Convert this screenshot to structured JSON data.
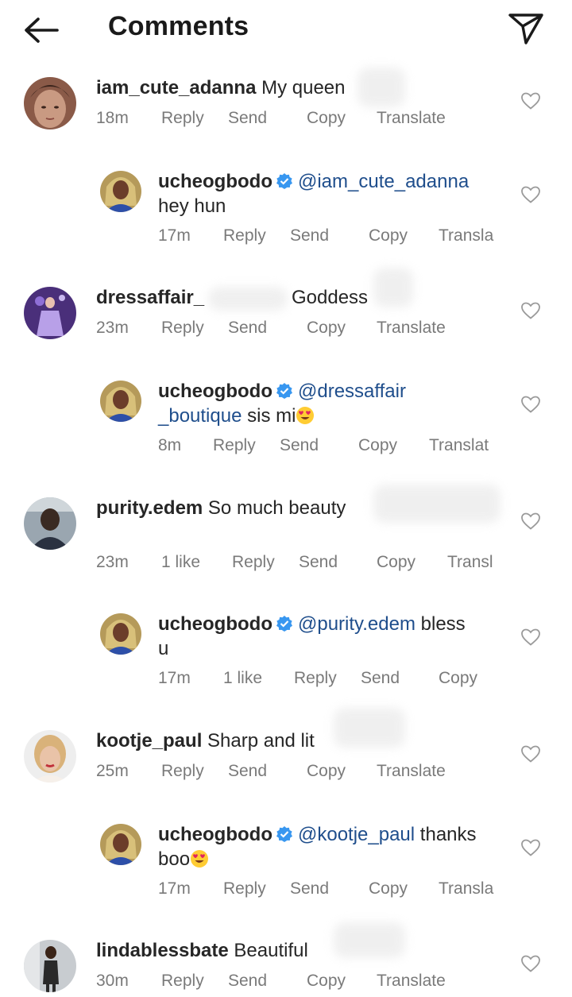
{
  "header": {
    "title": "Comments",
    "back_icon": "arrow-left-icon",
    "send_icon": "paper-plane-icon"
  },
  "comments": [
    {
      "user": "iam_cute_adanna",
      "text": "My queen",
      "time": "18m",
      "actions": [
        "Reply",
        "Send",
        "Copy",
        "Translate"
      ],
      "reply": {
        "user": "ucheogbodo",
        "verified": true,
        "mention": "@iam_cute_adanna",
        "text": "hey hun",
        "time": "17m",
        "actions": [
          "Reply",
          "Send",
          "Copy",
          "Transla"
        ]
      }
    },
    {
      "user": "dressaffair_",
      "text": "Goddess",
      "time": "23m",
      "actions": [
        "Reply",
        "Send",
        "Copy",
        "Translate"
      ],
      "reply": {
        "user": "ucheogbodo",
        "verified": true,
        "mention_line1": "@dressaffair",
        "mention_line2": "_boutique",
        "text": "sis mi",
        "time": "8m",
        "actions": [
          "Reply",
          "Send",
          "Copy",
          "Translat"
        ]
      }
    },
    {
      "user": "purity.edem",
      "text": "So much beauty",
      "time": "23m",
      "likes": "1 like",
      "actions": [
        "Reply",
        "Send",
        "Copy",
        "Transl"
      ],
      "reply": {
        "user": "ucheogbodo",
        "verified": true,
        "mention": "@purity.edem",
        "text_line1": "bless",
        "text_line2": "u",
        "time": "17m",
        "likes": "1 like",
        "actions": [
          "Reply",
          "Send",
          "Copy"
        ]
      }
    },
    {
      "user": "kootje_paul",
      "text": "Sharp and lit",
      "time": "25m",
      "actions": [
        "Reply",
        "Send",
        "Copy",
        "Translate"
      ],
      "reply": {
        "user": "ucheogbodo",
        "verified": true,
        "mention": "@kootje_paul",
        "text_line1": "thanks",
        "text_line2": "boo",
        "time": "17m",
        "actions": [
          "Reply",
          "Send",
          "Copy",
          "Transla"
        ]
      }
    },
    {
      "user": "lindablessbate",
      "text": "Beautiful",
      "time": "30m",
      "actions": [
        "Reply",
        "Send",
        "Copy",
        "Translate"
      ]
    }
  ],
  "icons": {
    "verified": "verified-badge-icon",
    "like": "heart-outline-icon",
    "emoji": "heart-eyes-emoji-icon"
  },
  "colors": {
    "text": "#262626",
    "meta": "#7a7a7a",
    "mention": "#1f4e8c",
    "verified": "#3897f0"
  }
}
